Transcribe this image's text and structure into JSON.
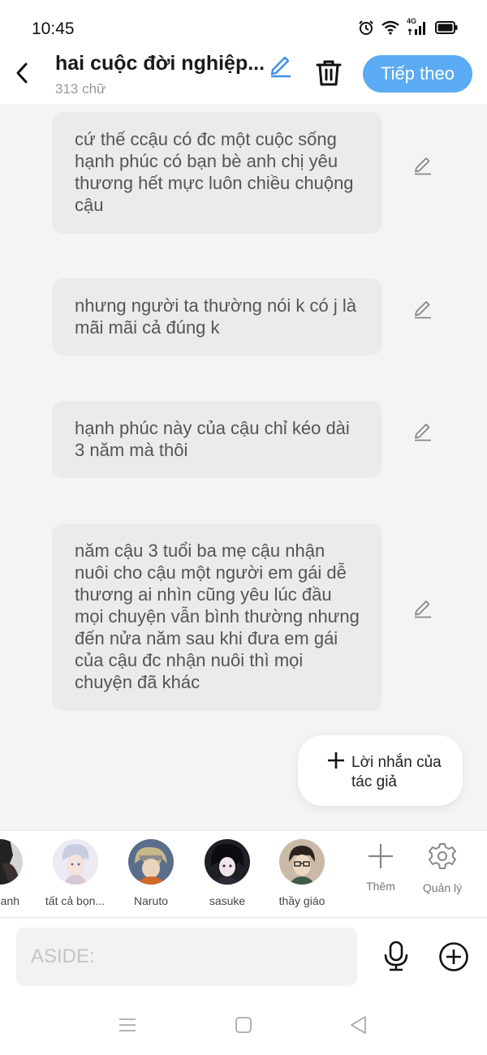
{
  "status_bar": {
    "time": "10:45",
    "network": "4G",
    "icons": [
      "alarm-icon",
      "wifi-icon",
      "signal-icon",
      "battery-icon"
    ]
  },
  "header": {
    "title": "hai cuộc đời nghiệp...",
    "word_count": "313 chữ",
    "next_label": "Tiếp theo",
    "accent_color": "#5aabf3"
  },
  "messages": [
    {
      "text": "cứ thế ccậu có đc một cuộc sống hạnh phúc  có bạn bè anh chị yêu thương hết mực luôn chiều chuộng cậu"
    },
    {
      "text": "nhưng người ta thường nói k có j là mãi mãi cả đúng k"
    },
    {
      "text": "hạnh phúc này của cậu chỉ kéo dài 3 năm mà thôi"
    },
    {
      "text": "năm cậu 3 tuổi ba mẹ cậu nhận nuôi cho cậu một người em gái dễ thương ai nhìn cũng yêu lúc đầu mọi chuyện vẫn bình thường nhưng đến nửa năm sau khi đưa em gái của cậu đc nhận nuôi thì mọi chuyện đã khác"
    }
  ],
  "author_note": {
    "label": "Lời nhắn của tác giả"
  },
  "characters": [
    {
      "name": "anh"
    },
    {
      "name": "tất cả bọn..."
    },
    {
      "name": "Naruto"
    },
    {
      "name": "sasuke"
    },
    {
      "name": "thầy giáo"
    }
  ],
  "tools": {
    "add_label": "Thêm",
    "manage_label": "Quản lý"
  },
  "input": {
    "placeholder": "ASIDE:"
  }
}
